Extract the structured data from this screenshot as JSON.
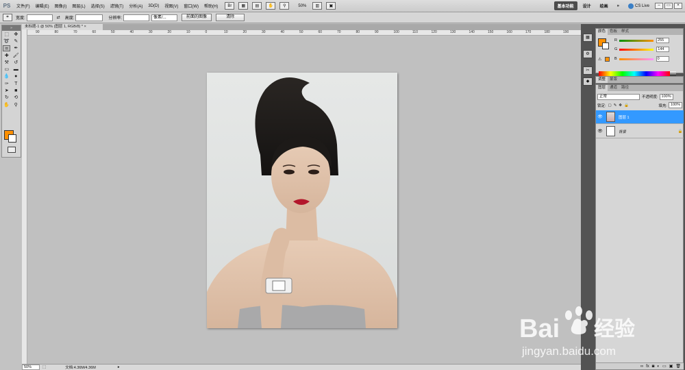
{
  "menubar": {
    "logo": "PS",
    "items": [
      "文件(F)",
      "编辑(E)",
      "图像(I)",
      "图层(L)",
      "选择(S)",
      "滤镜(T)",
      "分析(A)",
      "3D(D)",
      "视图(V)",
      "窗口(W)",
      "帮助(H)"
    ],
    "zoom": "50%",
    "workspaces": [
      "基本功能",
      "设计",
      "绘画"
    ],
    "cslive": "CS Live"
  },
  "options": {
    "width_label": "宽度:",
    "height_label": "高度:",
    "resolution_label": "分辨率:",
    "unit": "像素/...",
    "front_image_btn": "前面的图像",
    "clear_btn": "清除"
  },
  "document": {
    "tab_title": "未标题-1 @ 50% (图层 1, RGB/8) *",
    "ruler_top": [
      "90",
      "80",
      "70",
      "60",
      "50",
      "40",
      "30",
      "20",
      "10",
      "0",
      "10",
      "20",
      "30",
      "40",
      "50",
      "60",
      "70",
      "80",
      "90",
      "100",
      "110",
      "120",
      "130",
      "140",
      "150",
      "160",
      "170",
      "180",
      "190"
    ]
  },
  "status": {
    "zoom": "50%",
    "doc": "文档:4.36M/4.36M"
  },
  "color_panel": {
    "tabs": [
      "颜色",
      "色板",
      "样式"
    ],
    "r_label": "R",
    "r_value": "255",
    "g_label": "G",
    "g_value": "144",
    "b_label": "B",
    "b_value": "0",
    "fg": "#ff9000"
  },
  "adjust_panel": {
    "tabs": [
      "调整",
      "蒙版"
    ]
  },
  "layers_panel": {
    "tabs": [
      "图层",
      "通道",
      "路径"
    ],
    "blend_mode": "正常",
    "opacity_label": "不透明度:",
    "opacity": "100%",
    "lock_label": "锁定:",
    "fill_label": "填充:",
    "fill": "100%",
    "layers": [
      {
        "name": "图层 1",
        "selected": true
      },
      {
        "name": "背景",
        "selected": false
      }
    ]
  },
  "watermark": {
    "brand": "Bai",
    "brand2": "经验",
    "url": "jingyan.baidu.com"
  },
  "colors": {
    "foreground": "#ff9000",
    "selection": "#3399ff"
  }
}
